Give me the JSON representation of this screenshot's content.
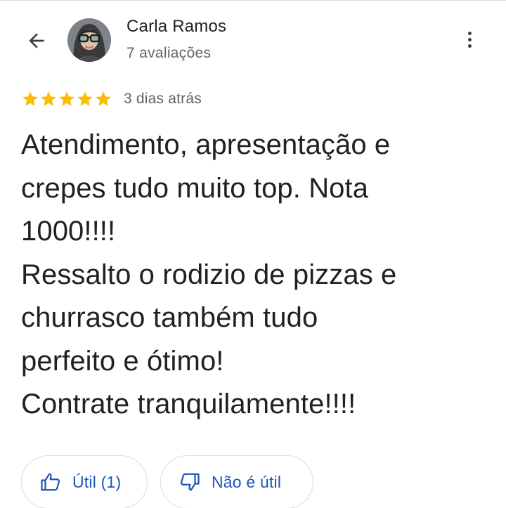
{
  "reviewer": {
    "name": "Carla Ramos",
    "review_count_label": "7 avaliações"
  },
  "review": {
    "rating": 5,
    "max_rating": 5,
    "date_label": "3 dias atrás",
    "text": "Atendimento, apresentação e\ncrepes tudo muito top. Nota\n1000!!!!\nRessalto o rodizio de pizzas e\nchurrasco também tudo\nperfeito e ótimo!\nContrate tranquilamente!!!!"
  },
  "actions": {
    "helpful_label": "Útil (1)",
    "not_helpful_label": "Não é útil"
  },
  "colors": {
    "star": "#fbbc04",
    "action_text": "#1a56b8",
    "border": "#dadce0"
  },
  "icons": {
    "back": "arrow-left-icon",
    "more": "more-vert-icon",
    "helpful": "thumb-up-icon",
    "not_helpful": "thumb-down-icon"
  }
}
